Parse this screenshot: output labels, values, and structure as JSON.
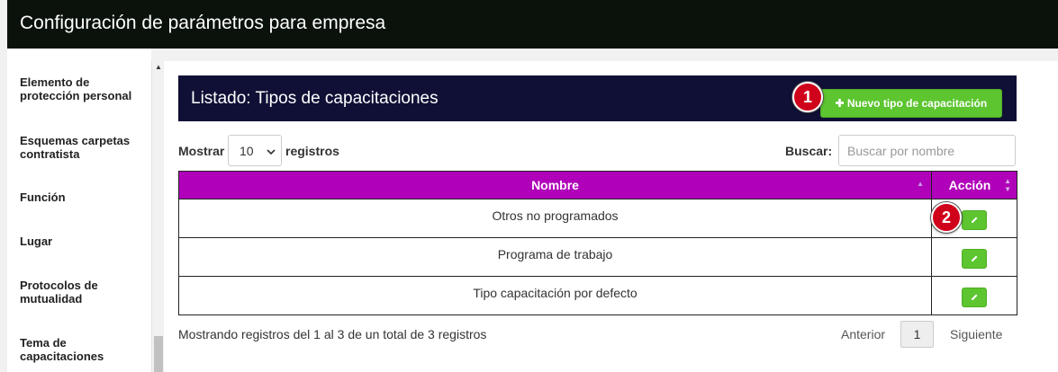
{
  "header": {
    "title": "Configuración de parámetros para empresa"
  },
  "sidebar": {
    "items": [
      {
        "label": "Elemento de protección personal"
      },
      {
        "label": "Esquemas carpetas contratista"
      },
      {
        "label": "Función"
      },
      {
        "label": "Lugar"
      },
      {
        "label": "Protocolos de mutualidad"
      },
      {
        "label": "Tema de capacitaciones"
      }
    ]
  },
  "panel": {
    "title": "Listado: Tipos de capacitaciones",
    "new_button_label": "Nuevo tipo de capacitación",
    "new_button_icon": "plus-icon"
  },
  "controls": {
    "show_label": "Mostrar",
    "page_size": "10",
    "records_label": "registros",
    "search_label": "Buscar:",
    "search_placeholder": "Buscar por nombre"
  },
  "table": {
    "columns": [
      "Nombre",
      "Acción"
    ],
    "rows": [
      {
        "name": "Otros no programados"
      },
      {
        "name": "Programa de trabajo"
      },
      {
        "name": "Tipo capacitación por defecto"
      }
    ],
    "edit_icon": "pencil-icon"
  },
  "footer": {
    "info": "Mostrando registros del 1 al 3 de un total de 3 registros",
    "prev": "Anterior",
    "current_page": "1",
    "next": "Siguiente"
  },
  "annotations": {
    "badge_1": "1",
    "badge_2": "2"
  },
  "colors": {
    "topbar": "#0b120c",
    "panel_header": "#101036",
    "table_header": "#b000b9",
    "button_green": "#5cc52f",
    "badge_red": "#d0021b"
  }
}
